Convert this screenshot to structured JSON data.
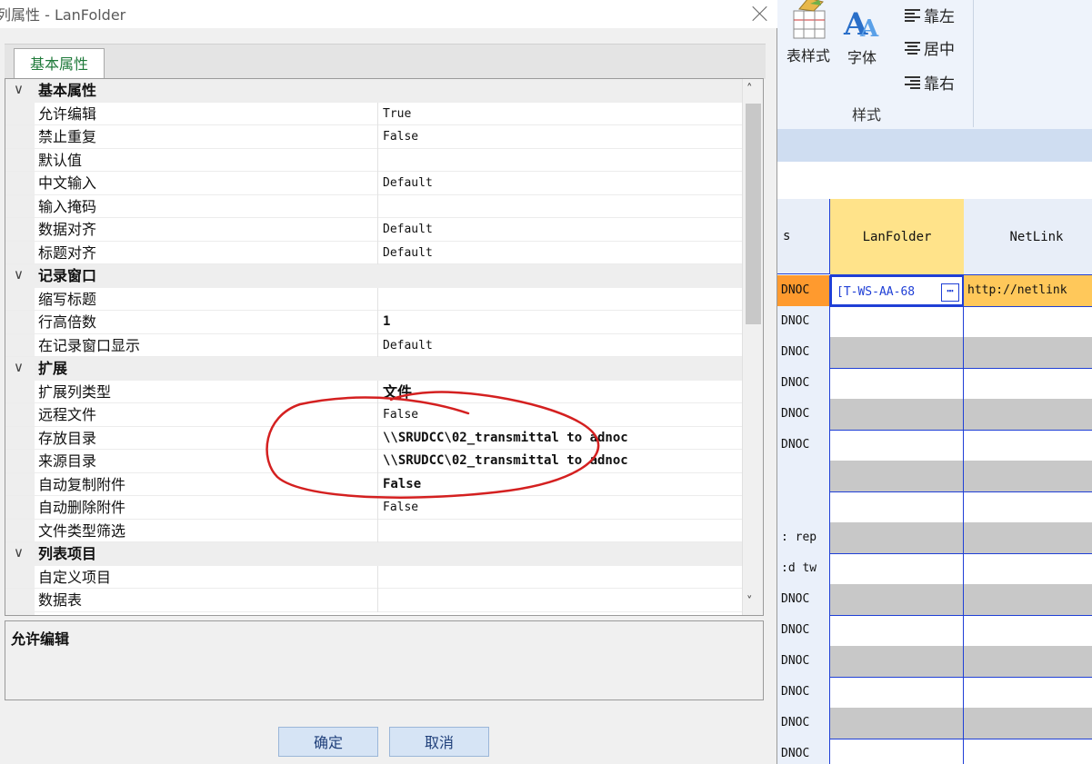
{
  "dialog": {
    "title": "列属性 - LanFolder",
    "tabs": [
      {
        "label": "基本属性"
      }
    ],
    "categories": [
      {
        "label": "基本属性",
        "items": [
          {
            "name": "允许编辑",
            "value": "True",
            "bold": false
          },
          {
            "name": "禁止重复",
            "value": "False",
            "bold": false
          },
          {
            "name": "默认值",
            "value": "",
            "bold": false
          },
          {
            "name": "中文输入",
            "value": "Default",
            "bold": false
          },
          {
            "name": "输入掩码",
            "value": "",
            "bold": false
          },
          {
            "name": "数据对齐",
            "value": "Default",
            "bold": false
          },
          {
            "name": "标题对齐",
            "value": "Default",
            "bold": false
          }
        ]
      },
      {
        "label": "记录窗口",
        "items": [
          {
            "name": "缩写标题",
            "value": "",
            "bold": false
          },
          {
            "name": "行高倍数",
            "value": "1",
            "bold": true
          },
          {
            "name": "在记录窗口显示",
            "value": "Default",
            "bold": false
          }
        ]
      },
      {
        "label": "扩展",
        "items": [
          {
            "name": "扩展列类型",
            "value": "文件",
            "bold": true,
            "cjk": true
          },
          {
            "name": "远程文件",
            "value": "False",
            "bold": false
          },
          {
            "name": "存放目录",
            "value": "\\\\SRUDCC\\02_transmittal to adnoc",
            "bold": true
          },
          {
            "name": "来源目录",
            "value": "\\\\SRUDCC\\02_transmittal to adnoc",
            "bold": true
          },
          {
            "name": "自动复制附件",
            "value": "False",
            "bold": true
          },
          {
            "name": "自动删除附件",
            "value": "False",
            "bold": false
          },
          {
            "name": "文件类型筛选",
            "value": "",
            "bold": false
          }
        ]
      },
      {
        "label": "列表项目",
        "items": [
          {
            "name": "自定义项目",
            "value": "",
            "bold": false
          },
          {
            "name": "数据表",
            "value": "",
            "bold": false
          }
        ]
      }
    ],
    "description_title": "允许编辑",
    "ok_label": "确定",
    "cancel_label": "取消"
  },
  "ribbon": {
    "table_style_label": "表样式",
    "font_label": "字体",
    "align_left": "靠左",
    "align_center": "居中",
    "align_right": "靠右",
    "group_label": "样式"
  },
  "grid": {
    "headers": [
      "s",
      "LanFolder",
      "NetLink"
    ],
    "rows": [
      {
        "c0": "DNOC",
        "c1": "[T-WS-AA-68",
        "c2": "http://netlink",
        "state": "selected"
      },
      {
        "c0": "DNOC",
        "c1": "",
        "c2": "",
        "state": "normal"
      },
      {
        "c0": "DNOC",
        "c1": "",
        "c2": "",
        "state": "alt"
      },
      {
        "c0": "DNOC",
        "c1": "",
        "c2": "",
        "state": "normal"
      },
      {
        "c0": "DNOC",
        "c1": "",
        "c2": "",
        "state": "alt"
      },
      {
        "c0": "DNOC",
        "c1": "",
        "c2": "",
        "state": "normal"
      },
      {
        "c0": "",
        "c1": "",
        "c2": "",
        "state": "alt"
      },
      {
        "c0": "",
        "c1": "",
        "c2": "",
        "state": "normal"
      },
      {
        "c0": ": rep",
        "c1": "",
        "c2": "",
        "state": "alt"
      },
      {
        "c0": ":d tw",
        "c1": "",
        "c2": "",
        "state": "normal"
      },
      {
        "c0": "DNOC",
        "c1": "",
        "c2": "",
        "state": "alt"
      },
      {
        "c0": "DNOC",
        "c1": "",
        "c2": "",
        "state": "normal"
      },
      {
        "c0": "DNOC",
        "c1": "",
        "c2": "",
        "state": "alt"
      },
      {
        "c0": "DNOC",
        "c1": "",
        "c2": "",
        "state": "normal"
      },
      {
        "c0": "DNOC",
        "c1": "",
        "c2": "",
        "state": "alt"
      },
      {
        "c0": "DNOC",
        "c1": "",
        "c2": "",
        "state": "normal"
      }
    ]
  },
  "colors": {
    "grid_border": "#1f3fd6",
    "selected_row": "#ff9a2e",
    "header_highlight": "#ffe38a",
    "annotation_red": "#d42020",
    "tab_text": "#1f7a3a"
  }
}
